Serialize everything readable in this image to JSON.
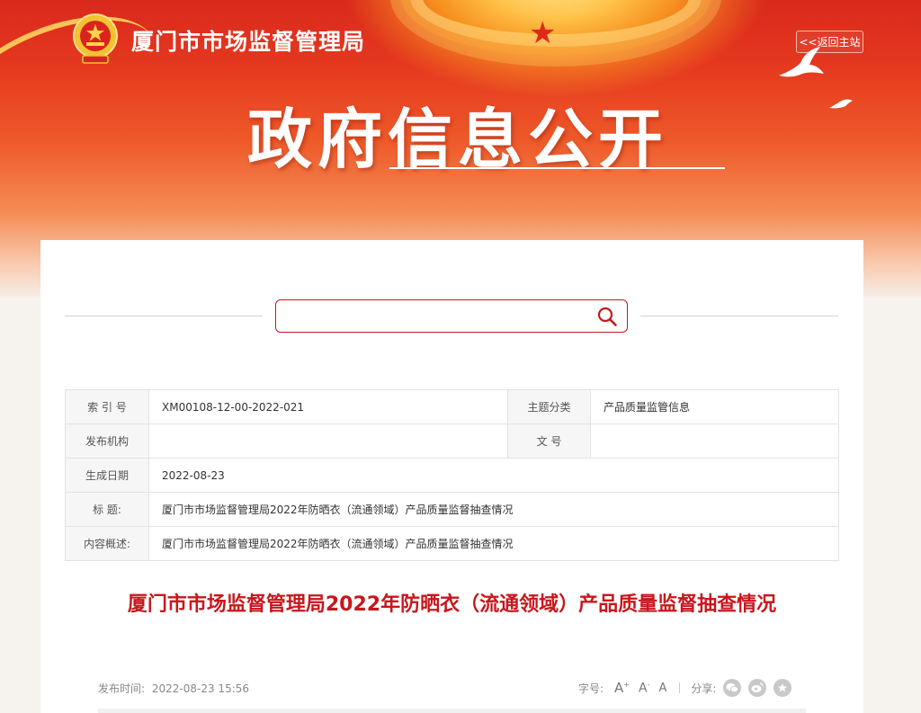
{
  "header": {
    "site_title": "厦门市市场监督管理局",
    "back_label": "<<返回主站",
    "hero_title": "政府信息公开"
  },
  "search": {
    "value": "",
    "placeholder": ""
  },
  "meta_table": {
    "index_label": "索 引 号",
    "index_value": "XM00108-12-00-2022-021",
    "topic_label": "主题分类",
    "topic_value": "产品质量监管信息",
    "publisher_label": "发布机构",
    "publisher_value": "",
    "docno_label": "文 号",
    "docno_value": "",
    "date_label": "生成日期",
    "date_value": "2022-08-23",
    "title_label": "标 题:",
    "title_value": "厦门市市场监督管理局2022年防晒衣（流通领域）产品质量监督抽查情况",
    "summary_label": "内容概述:",
    "summary_value": "厦门市市场监督管理局2022年防晒衣（流通领域）产品质量监督抽查情况"
  },
  "article": {
    "title": "厦门市市场监督管理局2022年防晒衣（流通领域）产品质量监督抽查情况",
    "pub_label": "发布时间:",
    "pub_time": "2022-08-23 15:56",
    "font_label": "字号:",
    "font_large": "A",
    "font_medium": "A",
    "font_small": "A",
    "share_label": "分享:",
    "share_icons": [
      "wechat-icon",
      "weibo-icon",
      "favorite-icon"
    ]
  },
  "colors": {
    "accent": "#c8161d",
    "banner_top": "#d9291c"
  }
}
